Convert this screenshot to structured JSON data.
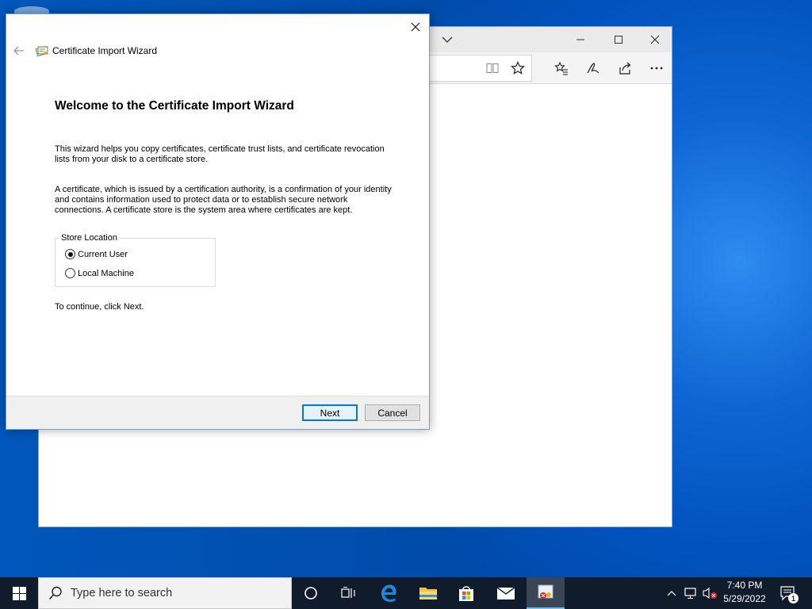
{
  "browser": {
    "title_controls": [
      "chevron-down-icon",
      "minimize-icon",
      "maximize-icon",
      "close-icon"
    ],
    "toolbar_icons": [
      "reading-view-icon",
      "favorite-star-icon",
      "favorites-hub-icon",
      "pen-icon",
      "share-icon",
      "more-icon"
    ]
  },
  "dialog": {
    "window_title": "Certificate Import Wizard",
    "heading": "Welcome to the Certificate Import Wizard",
    "para1_line1": "This wizard helps you copy certificates, certificate trust lists, and certificate revocation",
    "para1_line2": "lists from your disk to a certificate store.",
    "para2_line1": "A certificate, which is issued by a certification authority, is a confirmation of your identity",
    "para2_line2": "and contains information used to protect data or to establish secure network",
    "para2_line3": "connections. A certificate store is the system area where certificates are kept.",
    "store_location": {
      "label": "Store Location",
      "options": [
        {
          "label": "Current User",
          "checked": true
        },
        {
          "label": "Local Machine",
          "checked": false
        }
      ]
    },
    "continue_text": "To continue, click Next.",
    "next_label": "Next",
    "cancel_label": "Cancel"
  },
  "taskbar": {
    "search_placeholder": "Type here to search",
    "clock_time": "7:40 PM",
    "clock_date": "5/29/2022",
    "notification_count": "1",
    "accent": "#0078d7"
  }
}
